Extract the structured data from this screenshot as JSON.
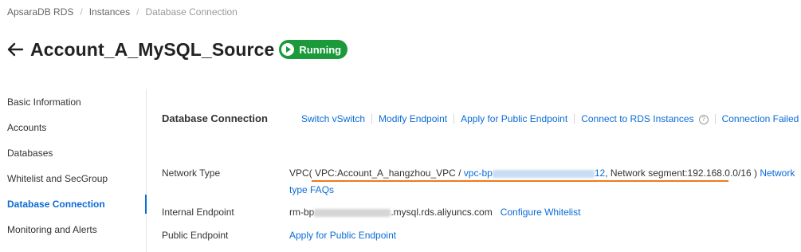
{
  "breadcrumb": [
    "ApsaraDB RDS",
    "Instances",
    "Database Connection"
  ],
  "header": {
    "title": "Account_A_MySQL_Source",
    "status": "Running"
  },
  "sidebar": {
    "items": [
      {
        "label": "Basic Information"
      },
      {
        "label": "Accounts"
      },
      {
        "label": "Databases"
      },
      {
        "label": "Whitelist and SecGroup"
      },
      {
        "label": "Database Connection",
        "active": true
      },
      {
        "label": "Monitoring and Alerts"
      }
    ]
  },
  "section": {
    "title": "Database Connection",
    "actions": [
      "Switch vSwitch",
      "Modify Endpoint",
      "Apply for Public Endpoint",
      "Connect to RDS Instances",
      "Connection Failed"
    ]
  },
  "network": {
    "label": "Network Type",
    "prefix": "VPC( VPC:Account_A_hangzhou_VPC / ",
    "vpc_start": "vpc-bp",
    "vpc_end": "12",
    "segment": ", Network segment:192.168.0.0/16 )",
    "faq_link_part1": "Network",
    "faq_link_part2": "type FAQs"
  },
  "internal": {
    "label": "Internal Endpoint",
    "value_start": "rm-bp",
    "value_end": ".mysql.rds.aliyuncs.com",
    "link": "Configure Whitelist"
  },
  "public": {
    "label": "Public Endpoint",
    "link": "Apply for Public Endpoint"
  },
  "colors": {
    "accent": "#0a6bd6",
    "running": "#1a9a3a",
    "highlight": "#ef7a1a"
  }
}
